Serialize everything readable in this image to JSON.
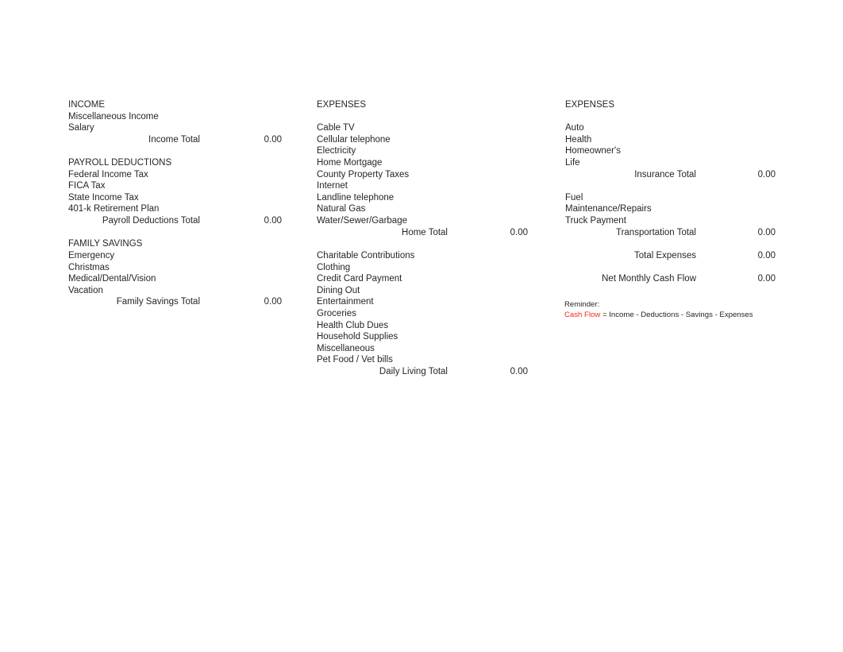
{
  "columns": {
    "left": {
      "sections": [
        {
          "heading": "INCOME",
          "items": [
            "Miscellaneous Income",
            "Salary"
          ],
          "total_label": "Income Total",
          "total_value": "0.00"
        },
        {
          "heading": "PAYROLL DEDUCTIONS",
          "items": [
            "Federal Income Tax",
            "FICA Tax",
            "State Income Tax",
            "401-k Retirement Plan"
          ],
          "total_label": "Payroll Deductions Total",
          "total_value": "0.00"
        },
        {
          "heading": "FAMILY SAVINGS",
          "items": [
            "Emergency",
            "Christmas",
            "Medical/Dental/Vision",
            "Vacation"
          ],
          "total_label": "Family Savings Total",
          "total_value": "0.00"
        }
      ]
    },
    "middle": {
      "sections": [
        {
          "heading": "EXPENSES",
          "items": [
            "Cable TV",
            "Cellular telephone",
            "Electricity",
            "Home Mortgage",
            "County Property Taxes",
            "Internet",
            "Landline telephone",
            "Natural Gas",
            "Water/Sewer/Garbage"
          ],
          "total_label": "Home Total",
          "total_value": "0.00"
        },
        {
          "heading": "",
          "items": [
            "Charitable Contributions",
            "Clothing",
            "Credit Card Payment",
            "Dining Out",
            "Entertainment",
            "Groceries",
            "Health Club Dues",
            "Household Supplies",
            "Miscellaneous",
            "Pet Food / Vet bills"
          ],
          "total_label": "Daily Living Total",
          "total_value": "0.00"
        }
      ]
    },
    "right": {
      "sections": [
        {
          "heading": "EXPENSES",
          "items": [
            "Auto",
            "Health",
            "Homeowner's",
            "Life"
          ],
          "total_label": "Insurance Total",
          "total_value": "0.00"
        },
        {
          "heading": "",
          "items": [
            "Fuel",
            "Maintenance/Repairs",
            "Truck Payment"
          ],
          "total_label": "Transportation Total",
          "total_value": "0.00"
        }
      ],
      "grand_totals": [
        {
          "label": "Total Expenses",
          "value": "0.00"
        },
        {
          "label": "Net Monthly Cash Flow",
          "value": "0.00"
        }
      ]
    }
  },
  "reminder": {
    "title": "Reminder:",
    "term": "Cash Flow",
    "formula": " = Income - Deductions - Savings - Expenses",
    "term_color": "#ED2B19"
  }
}
